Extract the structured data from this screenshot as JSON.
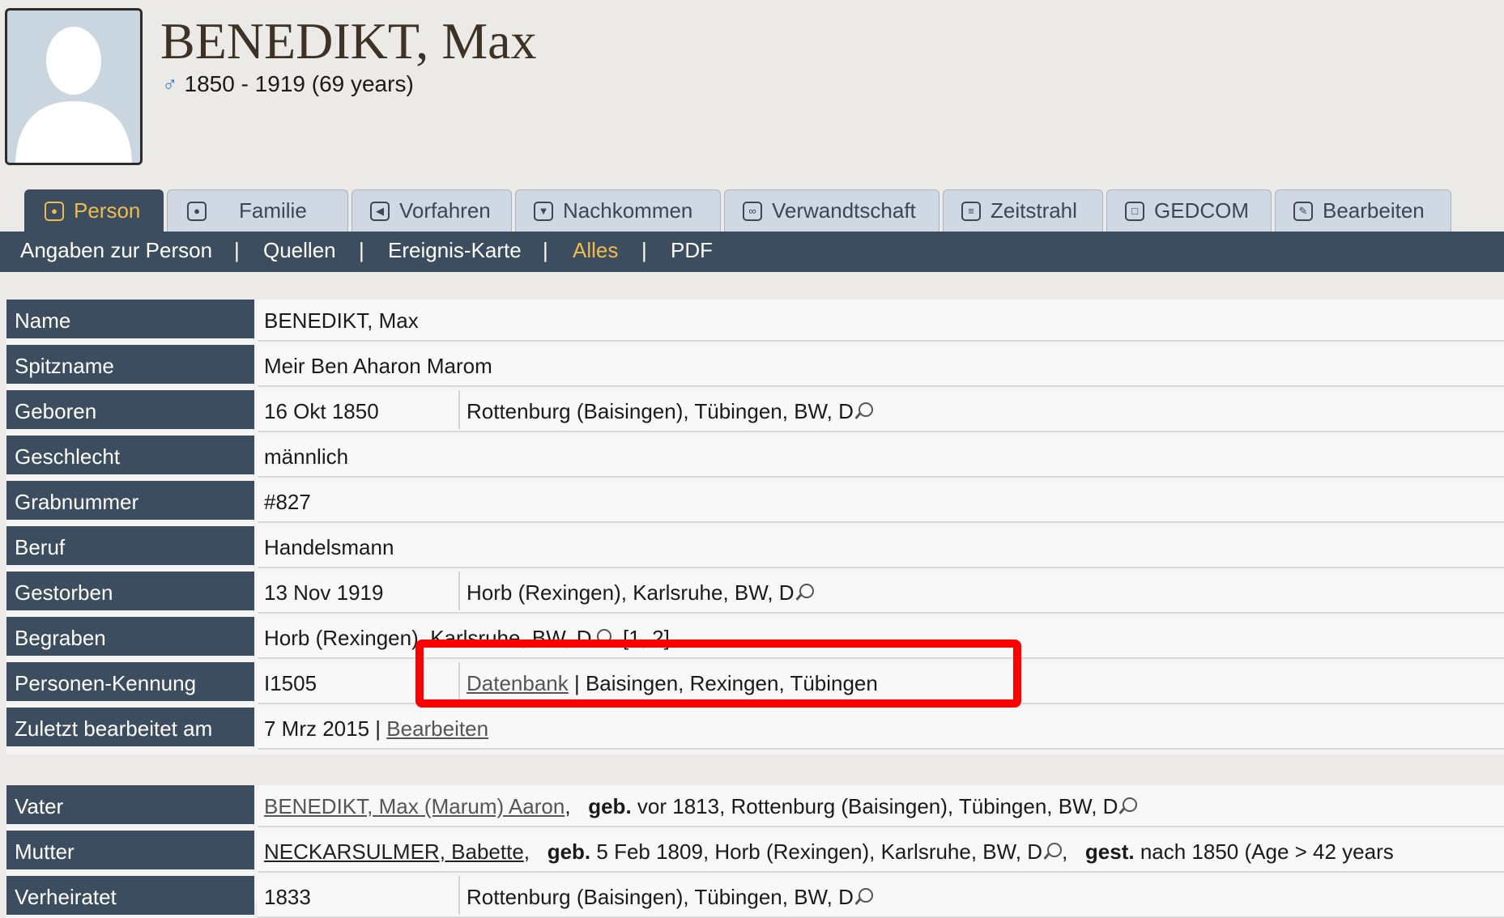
{
  "person": {
    "name": "BENEDIKT, Max",
    "gender_symbol": "♂",
    "lifespan": "1850 - 1919  (69 years)"
  },
  "tabs": [
    {
      "label": "Person",
      "icon": "person-icon"
    },
    {
      "label": "Familie",
      "icon": "family-icon"
    },
    {
      "label": "Vorfahren",
      "icon": "ancestors-icon"
    },
    {
      "label": "Nachkommen",
      "icon": "descendants-icon"
    },
    {
      "label": "Verwandtschaft",
      "icon": "relationship-icon"
    },
    {
      "label": "Zeitstrahl",
      "icon": "timeline-icon"
    },
    {
      "label": "GEDCOM",
      "icon": "gedcom-icon"
    },
    {
      "label": "Bearbeiten",
      "icon": "edit-icon"
    }
  ],
  "subnav": [
    "Angaben zur Person",
    "Quellen",
    "Ereignis-Karte",
    "Alles",
    "PDF"
  ],
  "subnav_sep": "|",
  "details": {
    "name": {
      "label": "Name",
      "value": "BENEDIKT, Max"
    },
    "nickname": {
      "label": "Spitzname",
      "value": "Meir Ben Aharon Marom"
    },
    "born": {
      "label": "Geboren",
      "date": "16 Okt 1850",
      "place": "Rottenburg (Baisingen), Tübingen, BW, D"
    },
    "sex": {
      "label": "Geschlecht",
      "value": "männlich"
    },
    "grave": {
      "label": "Grabnummer",
      "value": "#827"
    },
    "occupation": {
      "label": "Beruf",
      "value": "Handelsmann"
    },
    "died": {
      "label": "Gestorben",
      "date": "13 Nov 1919",
      "place": "Horb (Rexingen), Karlsruhe, BW, D"
    },
    "buried": {
      "label": "Begraben",
      "place": "Horb (Rexingen), Karlsruhe, BW, D",
      "sources": "[1, 2]"
    },
    "person_id": {
      "label": "Personen-Kennung",
      "value": "I1505",
      "link": "Datenbank",
      "rest": " | Baisingen, Rexingen, Tübingen"
    },
    "last_edit": {
      "label": "Zuletzt bearbeitet am",
      "value": "7 Mrz 2015 | ",
      "link": "Bearbeiten"
    }
  },
  "family": {
    "father": {
      "label": "Vater",
      "name": "BENEDIKT, Max (Marum) Aaron",
      "born_label": "geb.",
      "born": "vor 1813, Rottenburg (Baisingen), Tübingen, BW, D"
    },
    "mother": {
      "label": "Mutter",
      "name": "NECKARSULMER, Babette",
      "born_label": "geb.",
      "born": "5 Feb 1809, Horb (Rexingen), Karlsruhe, BW, D",
      "died_label": "gest.",
      "died": "nach 1850  (Age > 42 years"
    },
    "married": {
      "label": "Verheiratet",
      "date": "1833",
      "place": "Rottenburg (Baisingen), Tübingen, BW, D"
    }
  },
  "colors": {
    "header_bar": "#3d4d60",
    "accent": "#f0bc4b",
    "highlight": "#ff0000"
  }
}
